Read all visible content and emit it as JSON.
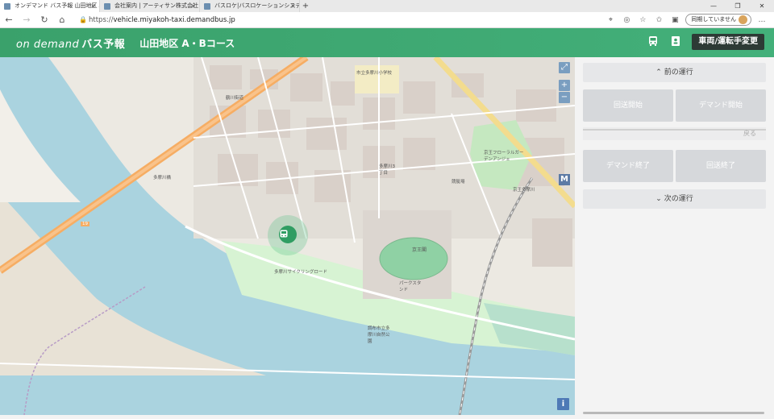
{
  "browser": {
    "tabs": [
      {
        "title": "オンデマンド バス予報 山田地区 A・B"
      },
      {
        "title": "会社案内 | アーティサン株式会社"
      },
      {
        "title": "バスロケ|バスロケーションシステム|バス"
      }
    ],
    "url_prefix": "https://",
    "url_host": "vehicle.miyakoh-taxi.demandbus.jp",
    "sync_label": "同期していません"
  },
  "header": {
    "logo_text": "on demand",
    "logo_sub": "バス予報",
    "course_title": "山田地区 A・Bコース",
    "vehicle_button": "車両/運転手変更"
  },
  "panel": {
    "prev_label": "前の運行",
    "next_label": "次の運行",
    "btn_return_start": "回送開始",
    "btn_demand_start": "デマンド開始",
    "btn_demand_end": "デマンド終了",
    "btn_return_end": "回送終了",
    "back_label": "戻る"
  },
  "map": {
    "labels": {
      "ichinomiya_school": "市立多摩川小学校",
      "tama_river_cycling": "多摩川サイクリングロード",
      "keio_flower": "京王フローラルガーデンアンジェ",
      "keio_kaku": "京王閣",
      "park_stand": "パークスタンド",
      "park_name": "調布市立多摩川自然公園",
      "route19": "19",
      "tsurukawa": "鶴川街道",
      "tamagawa3": "多摩川3丁目",
      "keio_tamagawa": "京王多摩川",
      "mizuhome": "水道局",
      "kyoutei": "競艇場",
      "yamaguchi": "多摩川橋"
    }
  },
  "icons": {
    "bus": "bus-icon",
    "person_card": "id-card-icon",
    "info": "info-icon",
    "expand": "expand-icon",
    "zoom_in": "plus-icon",
    "zoom_out": "minus-icon"
  }
}
